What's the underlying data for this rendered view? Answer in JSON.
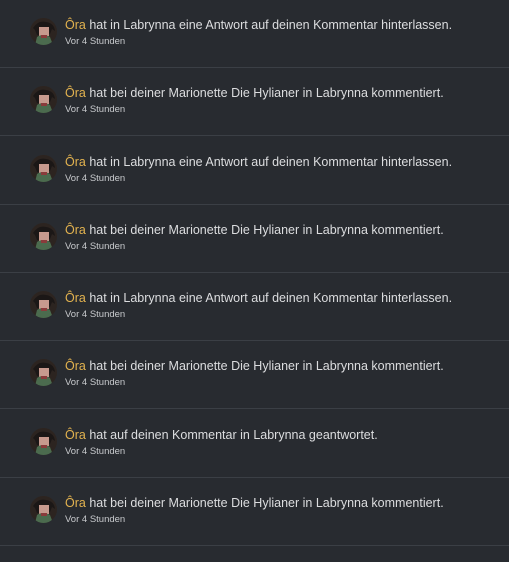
{
  "notifications": [
    {
      "actor": "Ôra",
      "pre": " hat in ",
      "target": "Labrynna",
      "post": " eine Antwort auf deinen Kommentar hinterlassen.",
      "time": "Vor 4 Stunden",
      "avatar_icon": "user-avatar-icon"
    },
    {
      "actor": "Ôra",
      "pre": " hat bei deiner Marionette Die Hylianer in ",
      "target": "Labrynna",
      "post": " kommentiert.",
      "time": "Vor 4 Stunden",
      "avatar_icon": "user-avatar-icon"
    },
    {
      "actor": "Ôra",
      "pre": " hat in ",
      "target": "Labrynna",
      "post": " eine Antwort auf deinen Kommentar hinterlassen.",
      "time": "Vor 4 Stunden",
      "avatar_icon": "user-avatar-icon"
    },
    {
      "actor": "Ôra",
      "pre": " hat bei deiner Marionette Die Hylianer in ",
      "target": "Labrynna",
      "post": " kommentiert.",
      "time": "Vor 4 Stunden",
      "avatar_icon": "user-avatar-icon"
    },
    {
      "actor": "Ôra",
      "pre": " hat in ",
      "target": "Labrynna",
      "post": " eine Antwort auf deinen Kommentar hinterlassen.",
      "time": "Vor 4 Stunden",
      "avatar_icon": "user-avatar-icon"
    },
    {
      "actor": "Ôra",
      "pre": " hat bei deiner Marionette Die Hylianer in ",
      "target": "Labrynna",
      "post": " kommentiert.",
      "time": "Vor 4 Stunden",
      "avatar_icon": "user-avatar-icon"
    },
    {
      "actor": "Ôra",
      "pre": " hat auf deinen Kommentar in ",
      "target": "Labrynna",
      "post": " geantwortet.",
      "time": "Vor 4 Stunden",
      "avatar_icon": "user-avatar-icon"
    },
    {
      "actor": "Ôra",
      "pre": " hat bei deiner Marionette Die Hylianer in ",
      "target": "Labrynna",
      "post": " kommentiert.",
      "time": "Vor 4 Stunden",
      "avatar_icon": "user-avatar-icon"
    }
  ],
  "colors": {
    "background": "#282b30",
    "divider": "#3b3f45",
    "actor": "#e2b24f",
    "text": "#dcdddf",
    "time": "#c8cacd"
  }
}
